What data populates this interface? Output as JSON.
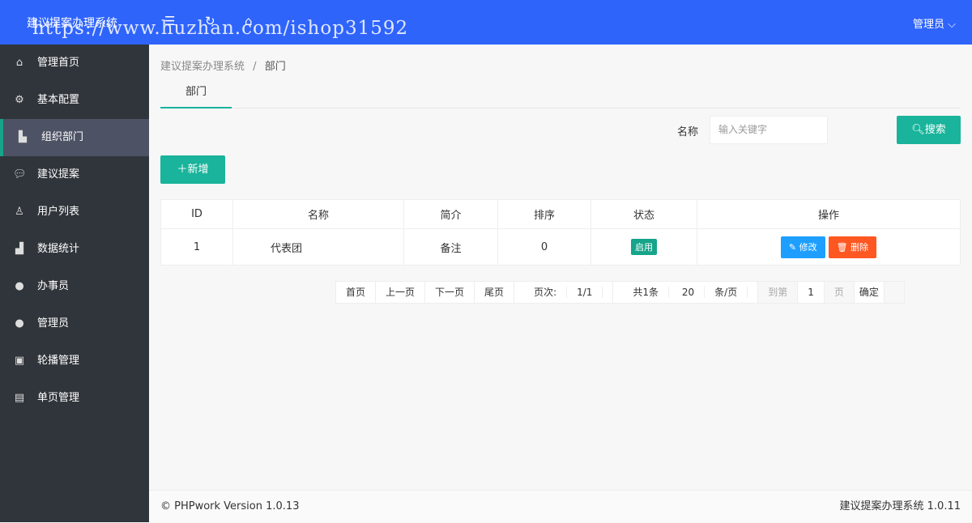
{
  "header": {
    "title": "建议提案办理系统",
    "user": "管理员",
    "watermark": "https://www.huzhan.com/ishop31592",
    "brand_color": "#2f64fb"
  },
  "sidebar": {
    "items": [
      {
        "label": "管理首页",
        "icon": "home-icon"
      },
      {
        "label": "基本配置",
        "icon": "gear-icon"
      },
      {
        "label": "组织部门",
        "icon": "sitemap-icon",
        "active": true
      },
      {
        "label": "建议提案",
        "icon": "chat-icon"
      },
      {
        "label": "用户列表",
        "icon": "users-icon"
      },
      {
        "label": "数据统计",
        "icon": "bar-chart-icon"
      },
      {
        "label": "办事员",
        "icon": "user-icon"
      },
      {
        "label": "管理员",
        "icon": "user-icon"
      },
      {
        "label": "轮播管理",
        "icon": "image-icon"
      },
      {
        "label": "单页管理",
        "icon": "file-icon"
      }
    ]
  },
  "breadcrumb": {
    "root": "建议提案办理系统",
    "sep": "/",
    "current": "部门"
  },
  "tab": "部门",
  "search": {
    "label": "名称",
    "placeholder": "输入关键字",
    "button": "搜索"
  },
  "add_button": "新增",
  "table": {
    "headers": [
      "ID",
      "名称",
      "简介",
      "排序",
      "状态",
      "操作"
    ],
    "rows": [
      {
        "id": "1",
        "name": "代表团",
        "intro": "备注",
        "sort": "0",
        "status": "启用",
        "edit": "修改",
        "delete": "删除"
      }
    ]
  },
  "pager": {
    "first": "首页",
    "prev": "上一页",
    "next": "下一页",
    "last": "尾页",
    "page_label": "页次:",
    "page_value": "1/1",
    "total_prefix": "共1条",
    "per_page": "20",
    "per_page_suffix": "条/页",
    "goto": "到第",
    "goto_value": "1",
    "page_unit": "页",
    "confirm": "确定"
  },
  "footer": {
    "left": "© PHPwork Version 1.0.13",
    "right": "建议提案办理系统 1.0.11"
  }
}
